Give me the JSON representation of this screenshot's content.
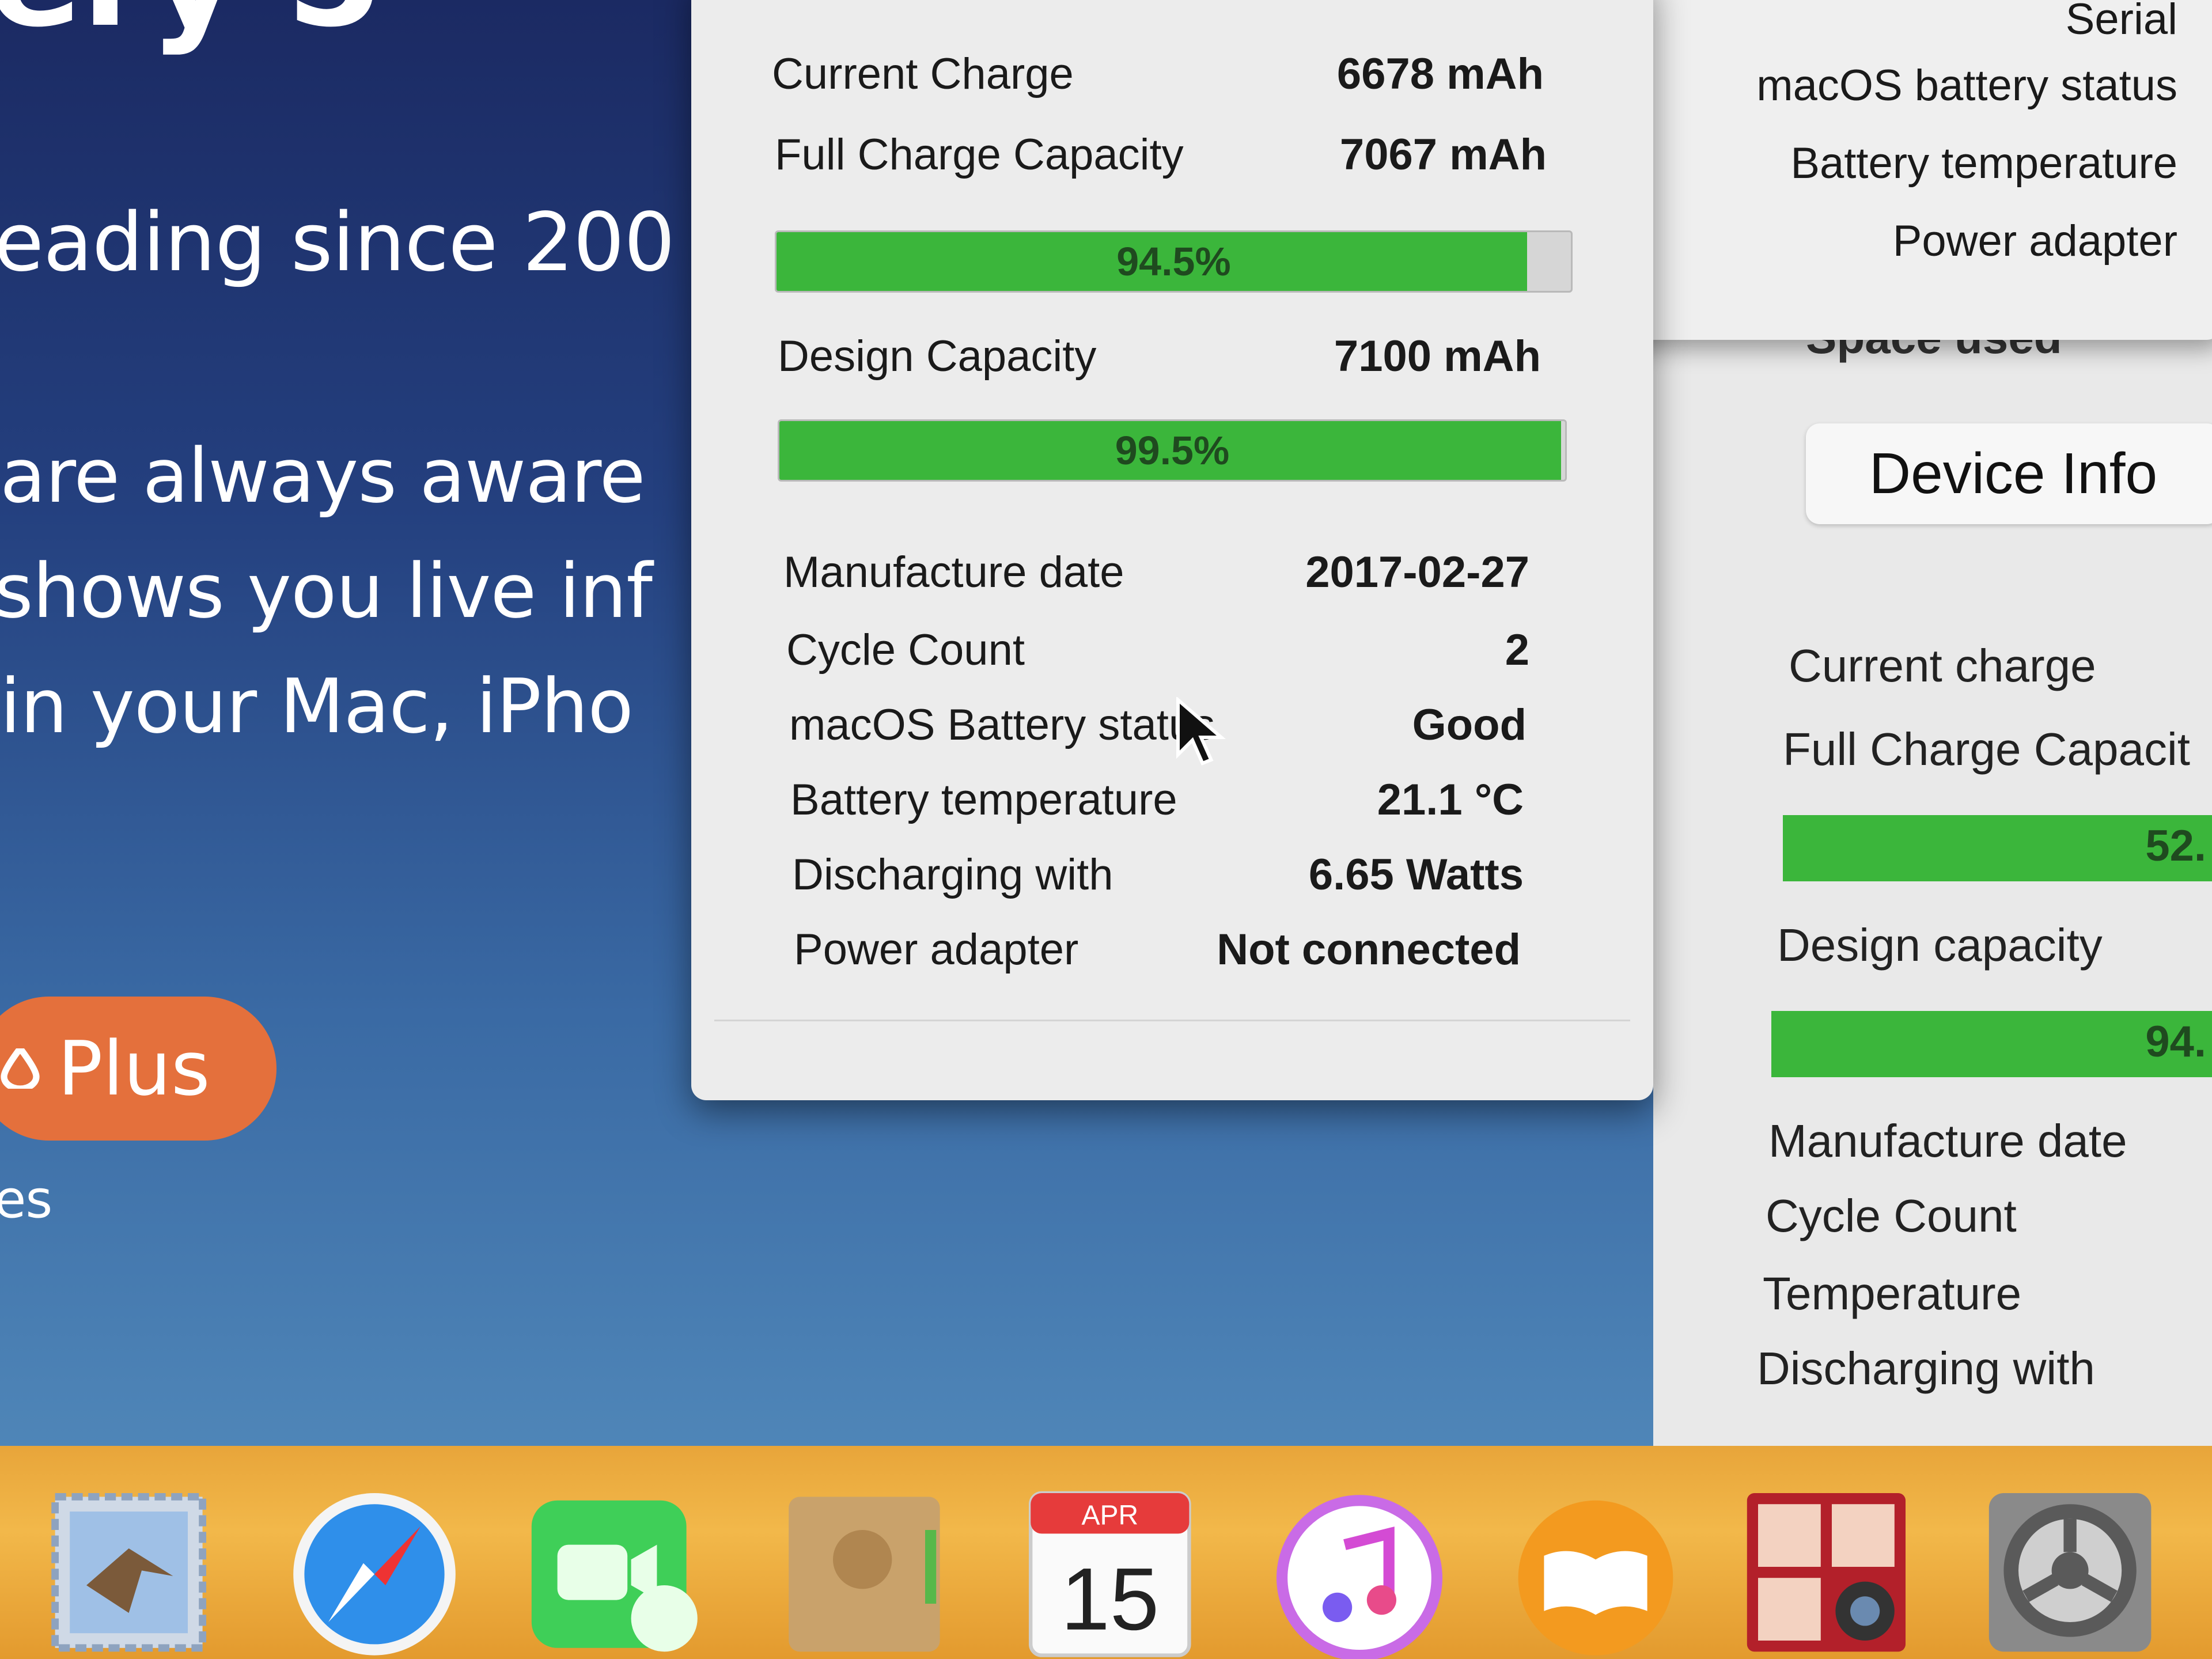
{
  "website": {
    "line1": "ery 5",
    "line2": "eading since 200",
    "line3": " are always aware",
    "line4": "shows you live inf",
    "line5": " in your Mac, iPho",
    "plus_button": "Plus",
    "line6": "es"
  },
  "popover": {
    "current_charge_label": "Current Charge",
    "current_charge_value": "6678 mAh",
    "full_charge_label": "Full Charge Capacity",
    "full_charge_value": "7067 mAh",
    "bar1_percent": 94.5,
    "bar1_label": "94.5%",
    "design_capacity_label": "Design Capacity",
    "design_capacity_value": "7100 mAh",
    "bar2_percent": 99.5,
    "bar2_label": "99.5%",
    "details": [
      {
        "label": "Manufacture date",
        "value": "2017-02-27"
      },
      {
        "label": "Cycle Count",
        "value": "2"
      },
      {
        "label": "macOS Battery status",
        "value": "Good"
      },
      {
        "label": "Battery temperature",
        "value": "21.1 °C"
      },
      {
        "label": "Discharging with",
        "value": "6.65 Watts"
      },
      {
        "label": "Power adapter",
        "value": "Not connected"
      }
    ]
  },
  "dropdown": {
    "items": [
      "Serial",
      "macOS battery status",
      "Battery temperature",
      "Power adapter"
    ]
  },
  "right_panel": {
    "space_used": "Space used",
    "device_info_button": "Device Info",
    "current_charge": "Current charge",
    "full_charge": "Full Charge Capacit",
    "bar1_text": "52.",
    "design_capacity": "Design capacity",
    "bar2_text": "94.",
    "manufacture_date": "Manufacture date",
    "cycle_count": "Cycle Count",
    "temperature": "Temperature",
    "discharging": "Discharging with"
  },
  "dock": {
    "calendar_month": "APR",
    "calendar_day": "15",
    "icons": [
      "mail-icon",
      "safari-icon",
      "facetime-icon",
      "contacts-icon",
      "calendar-icon",
      "itunes-icon",
      "ibooks-icon",
      "photo-booth-icon",
      "system-preferences-icon"
    ]
  },
  "colors": {
    "bar_green": "#3bb63b",
    "plus_orange": "#e4703c",
    "dock_yellow": "#f2b84a"
  }
}
